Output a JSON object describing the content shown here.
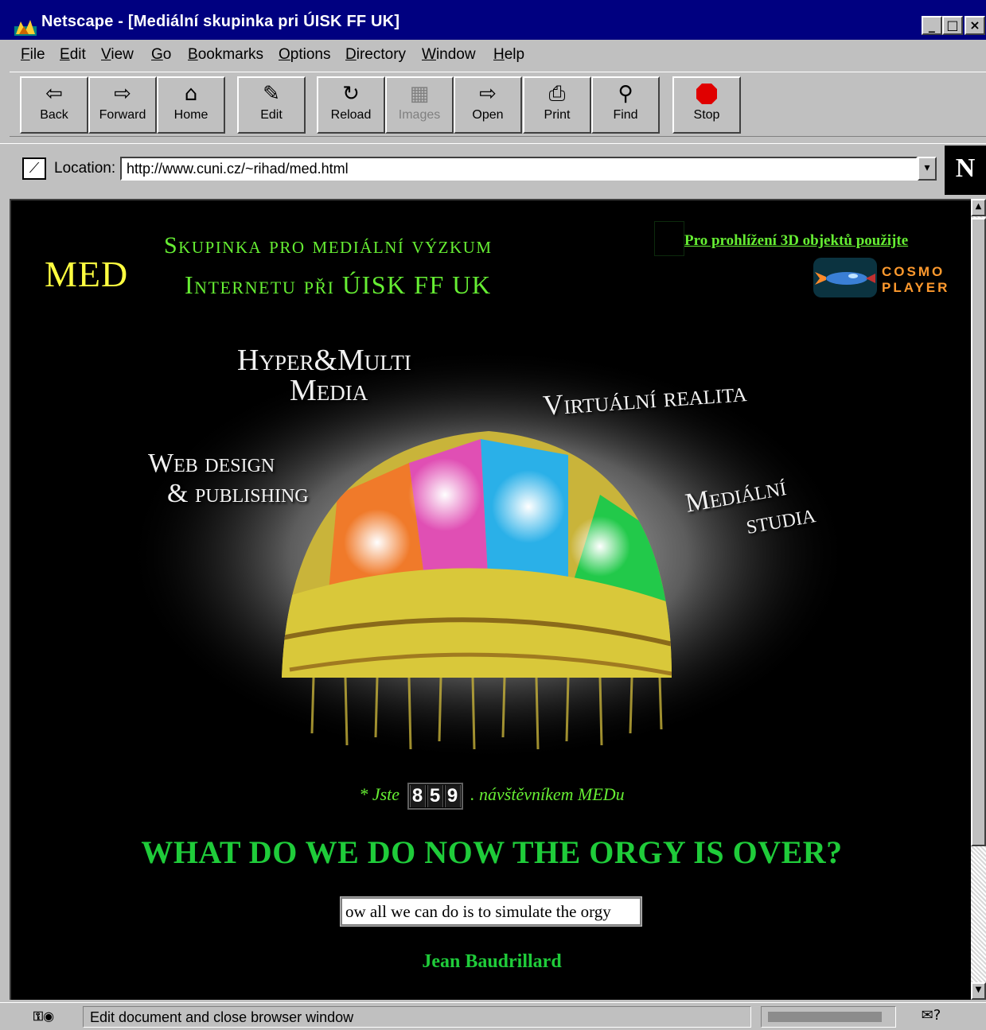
{
  "window": {
    "title": "Netscape - [Mediální skupinka pri ÚISK FF UK]",
    "controls": [
      "_",
      "□",
      "×"
    ]
  },
  "menu": [
    "File",
    "Edit",
    "View",
    "Go",
    "Bookmarks",
    "Options",
    "Directory",
    "Window",
    "Help"
  ],
  "toolbar": {
    "back": "Back",
    "forward": "Forward",
    "home": "Home",
    "edit": "Edit",
    "reload": "Reload",
    "images": "Images",
    "open": "Open",
    "print": "Print",
    "find": "Find",
    "stop": "Stop"
  },
  "location": {
    "label": "Location:",
    "url": "http://www.cuni.cz/~rihad/med.html"
  },
  "page": {
    "logo": "MED",
    "heading_line1": "Skupinka pro mediální výzkum",
    "heading_line2": "Internetu při ÚISK FF UK",
    "cosmo_link": "Pro prohlížení 3D objektů použijte",
    "cosmo_logo_line1": "COSMO",
    "cosmo_logo_line2": "PLAYER",
    "art": {
      "hyper_line1": "Hyper&Multi",
      "hyper_line2": "Media",
      "virtual": "Virtuální realita",
      "web_line1": "Web design",
      "web_line2": "& publishing",
      "media_line1": "Mediální",
      "media_line2": "studia"
    },
    "counter_prefix": "* Jste",
    "counter_digits": [
      "8",
      "5",
      "9"
    ],
    "counter_suffix": ". návštěvníkem MEDu",
    "quote_title": "WHAT DO WE DO NOW THE ORGY IS OVER?",
    "quote_input_value": "ow all we can do is to simulate the orgy",
    "author": "Jean Baudrillard"
  },
  "status": {
    "text": "Edit document and close browser window",
    "progress": 0.85
  },
  "colors": {
    "title_bar": "#000080",
    "chrome": "#c0c0c0",
    "page_bg": "#000000",
    "green": "#66ee33",
    "quote_green": "#1fcc3a",
    "logo_yellow": "#ffff40",
    "cosmo_orange": "#ff9a2e"
  },
  "icons": {
    "app": "netscape-icon",
    "back": "arrow-left-icon",
    "forward": "arrow-right-icon",
    "home": "home-icon",
    "edit": "pencil-icon",
    "reload": "reload-icon",
    "images": "images-icon",
    "open": "open-icon",
    "print": "printer-icon",
    "find": "binoculars-icon",
    "stop": "stop-icon",
    "location": "bookmark-icon",
    "mail": "mail-icon"
  }
}
